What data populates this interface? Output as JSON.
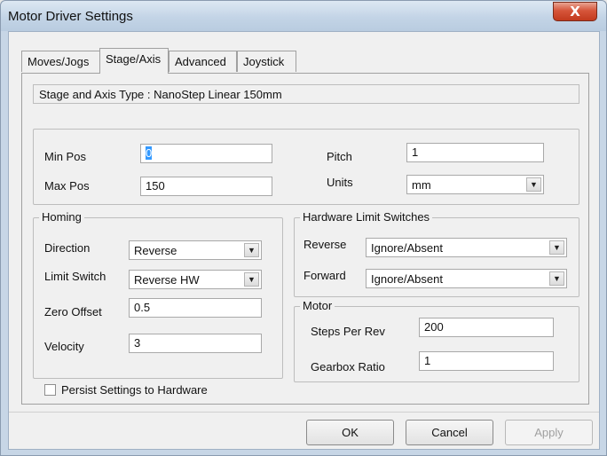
{
  "window": {
    "title": "Motor Driver Settings",
    "close_glyph": "X"
  },
  "tabs": [
    {
      "label": "Moves/Jogs"
    },
    {
      "label": "Stage/Axis"
    },
    {
      "label": "Advanced"
    },
    {
      "label": "Joystick"
    }
  ],
  "active_tab": "Stage/Axis",
  "stage_info": "Stage and Axis Type : NanoStep Linear 150mm",
  "limits": {
    "min_pos_label": "Min Pos",
    "min_pos_value": "0",
    "max_pos_label": "Max Pos",
    "max_pos_value": "150",
    "pitch_label": "Pitch",
    "pitch_value": "1",
    "units_label": "Units",
    "units_value": "mm"
  },
  "homing": {
    "title": "Homing",
    "direction_label": "Direction",
    "direction_value": "Reverse",
    "limit_switch_label": "Limit Switch",
    "limit_switch_value": "Reverse HW",
    "zero_offset_label": "Zero Offset",
    "zero_offset_value": "0.5",
    "velocity_label": "Velocity",
    "velocity_value": "3"
  },
  "hw_limits": {
    "title": "Hardware Limit Switches",
    "reverse_label": "Reverse",
    "reverse_value": "Ignore/Absent",
    "forward_label": "Forward",
    "forward_value": "Ignore/Absent"
  },
  "motor": {
    "title": "Motor",
    "steps_label": "Steps Per Rev",
    "steps_value": "200",
    "gearbox_label": "Gearbox Ratio",
    "gearbox_value": "1"
  },
  "persist_label": "Persist Settings to Hardware",
  "buttons": {
    "ok": "OK",
    "cancel": "Cancel",
    "apply": "Apply"
  }
}
